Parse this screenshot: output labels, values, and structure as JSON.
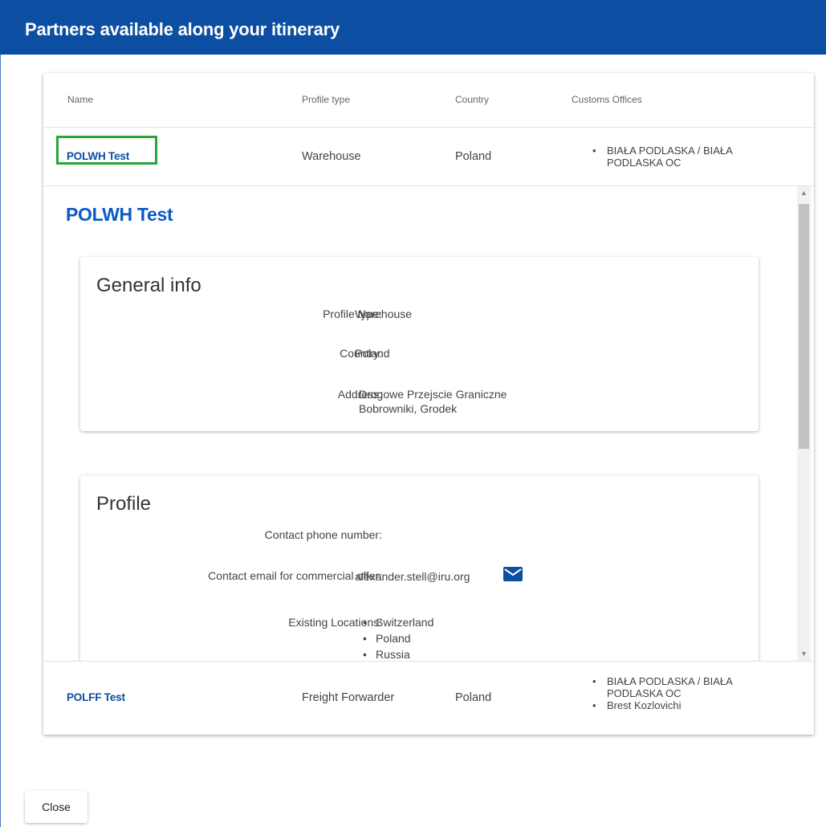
{
  "dialog": {
    "title": "Partners available along your itinerary",
    "close_label": "Close"
  },
  "table": {
    "headers": {
      "name": "Name",
      "profile_type": "Profile type",
      "country": "Country",
      "customs_offices": "Customs Offices"
    },
    "rows": [
      {
        "name": "POLWH Test",
        "profile_type": "Warehouse",
        "country": "Poland",
        "offices": [
          "BIAŁA PODLASKA / BIAŁA PODLASKA OC"
        ]
      },
      {
        "name": "POLFF Test",
        "profile_type": "Freight Forwarder",
        "country": "Poland",
        "offices": [
          "BIAŁA PODLASKA / BIAŁA PODLASKA OC",
          "Brest Kozlovichi"
        ]
      }
    ]
  },
  "detail": {
    "title": "POLWH Test",
    "general": {
      "heading": "General info",
      "profile_type_label": "Profile type:",
      "profile_type_value": "Warehouse",
      "country_label": "Country:",
      "country_value": "Poland",
      "address_label": "Address:",
      "address_line1": "Drogowe Przejscie Graniczne",
      "address_line2": "Bobrowniki, Grodek"
    },
    "profile": {
      "heading": "Profile",
      "phone_label": "Contact phone number:",
      "phone_value": "",
      "email_label": "Contact email for commercial offer:",
      "email_value": "alexander.stell@iru.org",
      "locations_label": "Existing Locations:",
      "locations": [
        "Switzerland",
        "Poland",
        "Russia"
      ]
    }
  },
  "colors": {
    "header_bg": "#0b4ea2",
    "link": "#0b4ea2",
    "selected_outline": "#2aa53a"
  },
  "icons": {
    "email": "envelope-icon"
  }
}
